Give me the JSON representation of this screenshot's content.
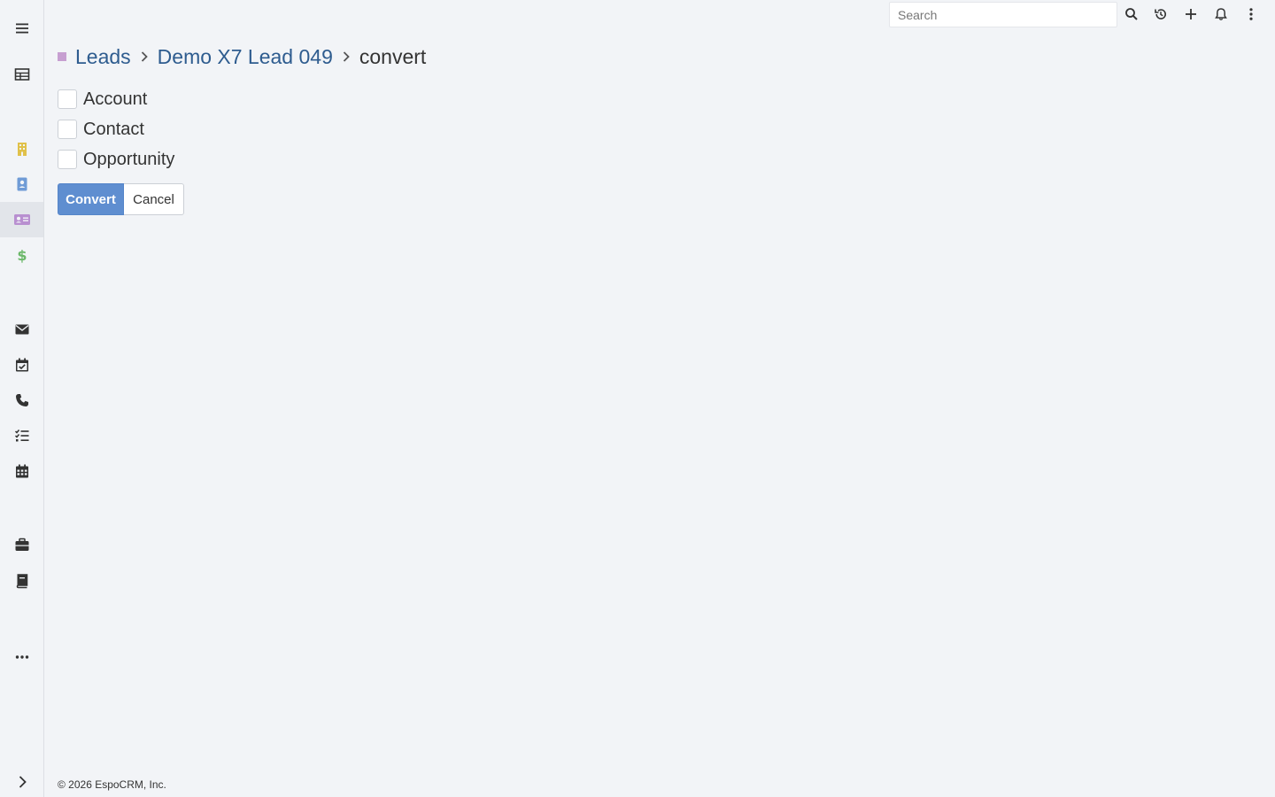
{
  "sidebar": {
    "items": [
      {
        "icon": "menu-icon",
        "color": "#333333"
      },
      {
        "icon": "table-icon",
        "color": "#333333"
      },
      {
        "icon": "building-icon",
        "color": "#e0c14a"
      },
      {
        "icon": "contact-card-icon",
        "color": "#6f9bd6"
      },
      {
        "icon": "lead-card-icon",
        "color": "#b88fd0",
        "active": true
      },
      {
        "icon": "dollar-icon",
        "color": "#6cb86a"
      },
      {
        "icon": "envelope-icon",
        "color": "#333333"
      },
      {
        "icon": "calendar-check-icon",
        "color": "#333333"
      },
      {
        "icon": "phone-icon",
        "color": "#333333"
      },
      {
        "icon": "tasks-icon",
        "color": "#333333"
      },
      {
        "icon": "calendar-icon",
        "color": "#333333"
      },
      {
        "icon": "briefcase-icon",
        "color": "#333333"
      },
      {
        "icon": "book-icon",
        "color": "#333333"
      },
      {
        "icon": "more-horizontal-icon",
        "color": "#333333"
      },
      {
        "icon": "chevron-right-icon",
        "color": "#333333"
      }
    ]
  },
  "navbar": {
    "search_placeholder": "Search",
    "icons": [
      "search-icon",
      "history-icon",
      "plus-icon",
      "bell-icon",
      "more-vertical-icon"
    ]
  },
  "breadcrumb": {
    "scope": "Leads",
    "record": "Demo X7 Lead 049",
    "action": "convert",
    "scope_color": "#c79fd1"
  },
  "convert_options": [
    {
      "label": "Account",
      "checked": false
    },
    {
      "label": "Contact",
      "checked": false
    },
    {
      "label": "Opportunity",
      "checked": false
    }
  ],
  "buttons": {
    "convert": "Convert",
    "cancel": "Cancel"
  },
  "footer": {
    "text": "© 2026 EspoCRM, Inc."
  },
  "colors": {
    "accent": "#5f8ed0",
    "link": "#2e5c8f",
    "background": "#f2f4f7"
  }
}
